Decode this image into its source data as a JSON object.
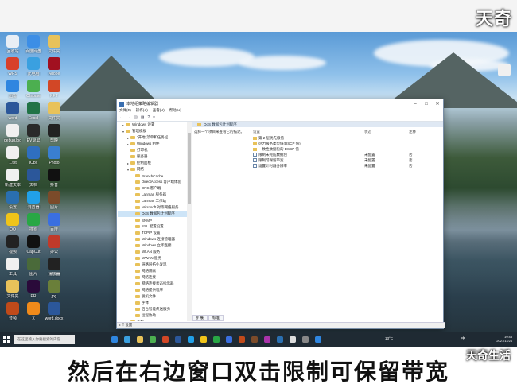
{
  "overlay": {
    "top_logo": "天奇",
    "subtitle": "然后在右边窗口双击限制可保留带宽",
    "brand": "天奇生活"
  },
  "desktop_icons": [
    {
      "label": "回收站",
      "color": "#e8eef5"
    },
    {
      "label": "百度网盘",
      "color": "#3c8ee6"
    },
    {
      "label": "文件夹",
      "color": "#e8c25a"
    },
    {
      "label": "WPS",
      "color": "#d8402a"
    },
    {
      "label": "此电脑",
      "color": "#3aa0e0"
    },
    {
      "label": "Adobe",
      "color": "#a11020"
    },
    {
      "label": "迅雷",
      "color": "#2f86e0"
    },
    {
      "label": "Chrome",
      "color": "#4caf50"
    },
    {
      "label": "PPT",
      "color": "#d24726"
    },
    {
      "label": "word",
      "color": "#2b579a"
    },
    {
      "label": "Excel",
      "color": "#217346"
    },
    {
      "label": "文件夹",
      "color": "#e8c25a"
    },
    {
      "label": "debug.log",
      "color": "#f0f0f0"
    },
    {
      "label": "EV录屏",
      "color": "#2a2a2a"
    },
    {
      "label": "剪映",
      "color": "#222"
    },
    {
      "label": "1.txt",
      "color": "#f0f0f0"
    },
    {
      "label": "iObit",
      "color": "#2f6fc0"
    },
    {
      "label": "Photo",
      "color": "#3a7fd0"
    },
    {
      "label": "新建文本",
      "color": "#f0f0f0"
    },
    {
      "label": "文档",
      "color": "#2b579a"
    },
    {
      "label": "抖音",
      "color": "#111"
    },
    {
      "label": "设置",
      "color": "#2a6fb0"
    },
    {
      "label": "浏览器",
      "color": "#21a0e8"
    },
    {
      "label": "图片",
      "color": "#7b4b2a"
    },
    {
      "label": "QQ",
      "color": "#f0c419"
    },
    {
      "label": "搜狗",
      "color": "#28a745"
    },
    {
      "label": "百度",
      "color": "#3a6fe0"
    },
    {
      "label": "视频",
      "color": "#222"
    },
    {
      "label": "CapCut",
      "color": "#111"
    },
    {
      "label": "办公",
      "color": "#c03a2a"
    },
    {
      "label": "工具",
      "color": "#f0f0f0"
    },
    {
      "label": "图片",
      "color": "#4a6a3a"
    },
    {
      "label": "播放器",
      "color": "#222"
    },
    {
      "label": "文件夹",
      "color": "#e8c25a"
    },
    {
      "label": "PR",
      "color": "#2a0a3a"
    },
    {
      "label": "jpg",
      "color": "#6a7f3a"
    },
    {
      "label": "音频",
      "color": "#c04a1a"
    },
    {
      "label": "X",
      "color": "#f08a1a"
    },
    {
      "label": "word.docx",
      "color": "#2b579a"
    }
  ],
  "window": {
    "title": "本地组策略编辑器",
    "menu": [
      "文件(F)",
      "操作(A)",
      "查看(V)",
      "帮助(H)"
    ],
    "toolbar_icons": [
      "back-icon",
      "forward-icon",
      "up-icon",
      "list-icon",
      "help-icon",
      "filter-icon"
    ],
    "tree": [
      {
        "indent": 1,
        "exp": "▸",
        "label": "Windows 设置"
      },
      {
        "indent": 1,
        "exp": "▾",
        "label": "管理模板"
      },
      {
        "indent": 2,
        "exp": "▸",
        "label": "\"开始\"菜单和任务栏"
      },
      {
        "indent": 2,
        "exp": "▸",
        "label": "Windows 组件"
      },
      {
        "indent": 2,
        "exp": "",
        "label": "打印机"
      },
      {
        "indent": 2,
        "exp": "",
        "label": "服务器"
      },
      {
        "indent": 2,
        "exp": "▸",
        "label": "控制面板"
      },
      {
        "indent": 2,
        "exp": "▾",
        "label": "网络"
      },
      {
        "indent": 3,
        "exp": "",
        "label": "BranchCache"
      },
      {
        "indent": 3,
        "exp": "",
        "label": "DirectAccess 客户端体验"
      },
      {
        "indent": 3,
        "exp": "",
        "label": "DNS 客户端"
      },
      {
        "indent": 3,
        "exp": "",
        "label": "Lanman 服务器"
      },
      {
        "indent": 3,
        "exp": "",
        "label": "Lanman 工作站"
      },
      {
        "indent": 3,
        "exp": "",
        "label": "Microsoft 对等网络服务"
      },
      {
        "indent": 3,
        "exp": "",
        "label": "QoS 数据包计划程序",
        "selected": true
      },
      {
        "indent": 3,
        "exp": "",
        "label": "SNMP"
      },
      {
        "indent": 3,
        "exp": "",
        "label": "SSL 配置设置"
      },
      {
        "indent": 3,
        "exp": "",
        "label": "TCPIP 设置"
      },
      {
        "indent": 3,
        "exp": "",
        "label": "Windows 连接管理器"
      },
      {
        "indent": 3,
        "exp": "",
        "label": "Windows 立即连接"
      },
      {
        "indent": 3,
        "exp": "",
        "label": "WLAN 服务"
      },
      {
        "indent": 3,
        "exp": "",
        "label": "WWAN 服务"
      },
      {
        "indent": 3,
        "exp": "",
        "label": "链路层拓扑发现"
      },
      {
        "indent": 3,
        "exp": "",
        "label": "网络隔离"
      },
      {
        "indent": 3,
        "exp": "",
        "label": "网络连接"
      },
      {
        "indent": 3,
        "exp": "",
        "label": "网络连接状态指示器"
      },
      {
        "indent": 3,
        "exp": "",
        "label": "网络提供程序"
      },
      {
        "indent": 3,
        "exp": "",
        "label": "脱机文件"
      },
      {
        "indent": 3,
        "exp": "",
        "label": "字体"
      },
      {
        "indent": 3,
        "exp": "",
        "label": "后台智能传送服务"
      },
      {
        "indent": 3,
        "exp": "",
        "label": "远程协助"
      },
      {
        "indent": 2,
        "exp": "▸",
        "label": "系统"
      }
    ],
    "pane_header": "QoS 数据包计划程序",
    "description": "选择一个项目来查看它的描述。",
    "columns": [
      "设置",
      "状态",
      "注释"
    ],
    "rows": [
      {
        "type": "folder",
        "name": "第 2 层优先级值",
        "state": "",
        "comment": ""
      },
      {
        "type": "folder",
        "name": "尽力服务类型值(DSCP 值)",
        "state": "",
        "comment": ""
      },
      {
        "type": "folder",
        "name": "一致性数据包的 DSCP 值",
        "state": "",
        "comment": ""
      },
      {
        "type": "setting",
        "name": "限制未完成数据包",
        "state": "未配置",
        "comment": "否"
      },
      {
        "type": "setting",
        "name": "限制可保留带宽",
        "state": "未配置",
        "comment": "否"
      },
      {
        "type": "setting",
        "name": "设置计时器分辨率",
        "state": "未配置",
        "comment": "否"
      }
    ],
    "tabs": [
      "扩展",
      "标准"
    ],
    "status": "3 个设置"
  },
  "taskbar": {
    "search_placeholder": "在这里输入你要搜索的内容",
    "apps": [
      "#2f86e0",
      "#3aa0e0",
      "#e8c25a",
      "#4caf50",
      "#d24726",
      "#2b579a",
      "#21a0e8",
      "#f0c419",
      "#28a745",
      "#3a6fe0",
      "#c04a1a",
      "#7b4b2a",
      "#aa33aa",
      "#2a6fb0",
      "#ddd",
      "#888",
      "#2f86e0"
    ],
    "weather": "13°C",
    "ime": "中",
    "clock_time": "19:48",
    "clock_date": "2021/11/24"
  }
}
